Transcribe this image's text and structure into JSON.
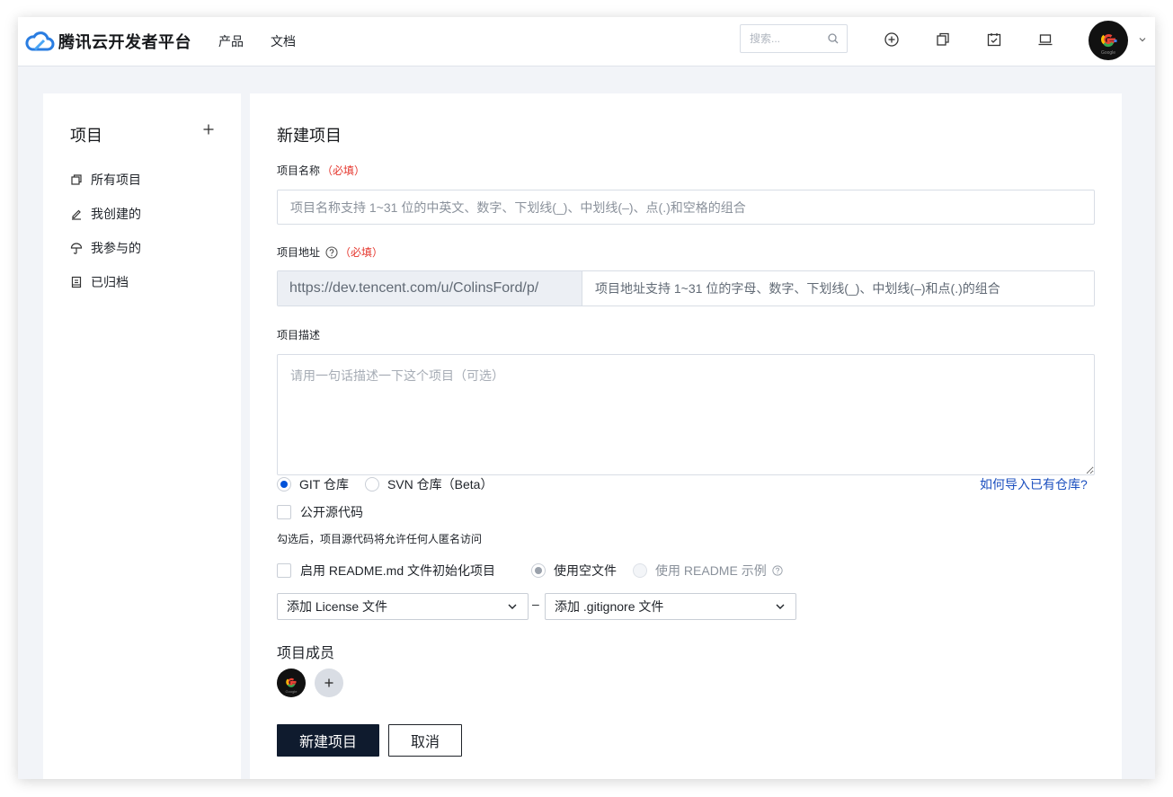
{
  "header": {
    "brand_name": "腾讯云开发者平台",
    "nav": [
      {
        "label": "产品"
      },
      {
        "label": "文档"
      }
    ],
    "search_placeholder": "搜索...",
    "icons": [
      "plus-circle-icon",
      "copy-icon",
      "calendar-check-icon",
      "laptop-icon"
    ],
    "avatar_text": "Google"
  },
  "sidebar": {
    "title": "项目",
    "items": [
      {
        "label": "所有项目",
        "icon": "projects-icon"
      },
      {
        "label": "我创建的",
        "icon": "edit-icon"
      },
      {
        "label": "我参与的",
        "icon": "participate-icon"
      },
      {
        "label": "已归档",
        "icon": "archive-icon"
      }
    ]
  },
  "form": {
    "title": "新建项目",
    "name": {
      "label": "项目名称",
      "required": "（必填）",
      "placeholder": "项目名称支持 1~31 位的中英文、数字、下划线(_)、中划线(–)、点(.)和空格的组合"
    },
    "url": {
      "label": "项目地址",
      "required": "（必填）",
      "prefix": "https://dev.tencent.com/u/ColinsFord/p/",
      "placeholder": "项目地址支持 1~31 位的字母、数字、下划线(_)、中划线(–)和点(.)的组合"
    },
    "description": {
      "label": "项目描述",
      "placeholder": "请用一句话描述一下这个项目（可选）"
    },
    "repo_type": {
      "options": [
        {
          "label": "GIT 仓库",
          "selected": true
        },
        {
          "label": "SVN 仓库（Beta）",
          "selected": false
        }
      ],
      "import_link": "如何导入已有仓库?"
    },
    "public_source": {
      "label": "公开源代码",
      "checked": false,
      "hint": "勾选后，项目源代码将允许任何人匿名访问"
    },
    "readme": {
      "label": "启用 README.md 文件初始化项目",
      "checked": false,
      "option_empty": "使用空文件",
      "option_example": "使用 README 示例"
    },
    "license_select": "添加 License 文件",
    "separator": "–",
    "gitignore_select": "添加 .gitignore 文件",
    "members_title": "项目成员",
    "member_avatar_text": "Google",
    "submit": "新建项目",
    "cancel": "取消"
  },
  "colors": {
    "accent": "#0052d9",
    "primary_button": "#0f1b2e",
    "required": "#e5352c",
    "link": "#1b4fbf"
  }
}
